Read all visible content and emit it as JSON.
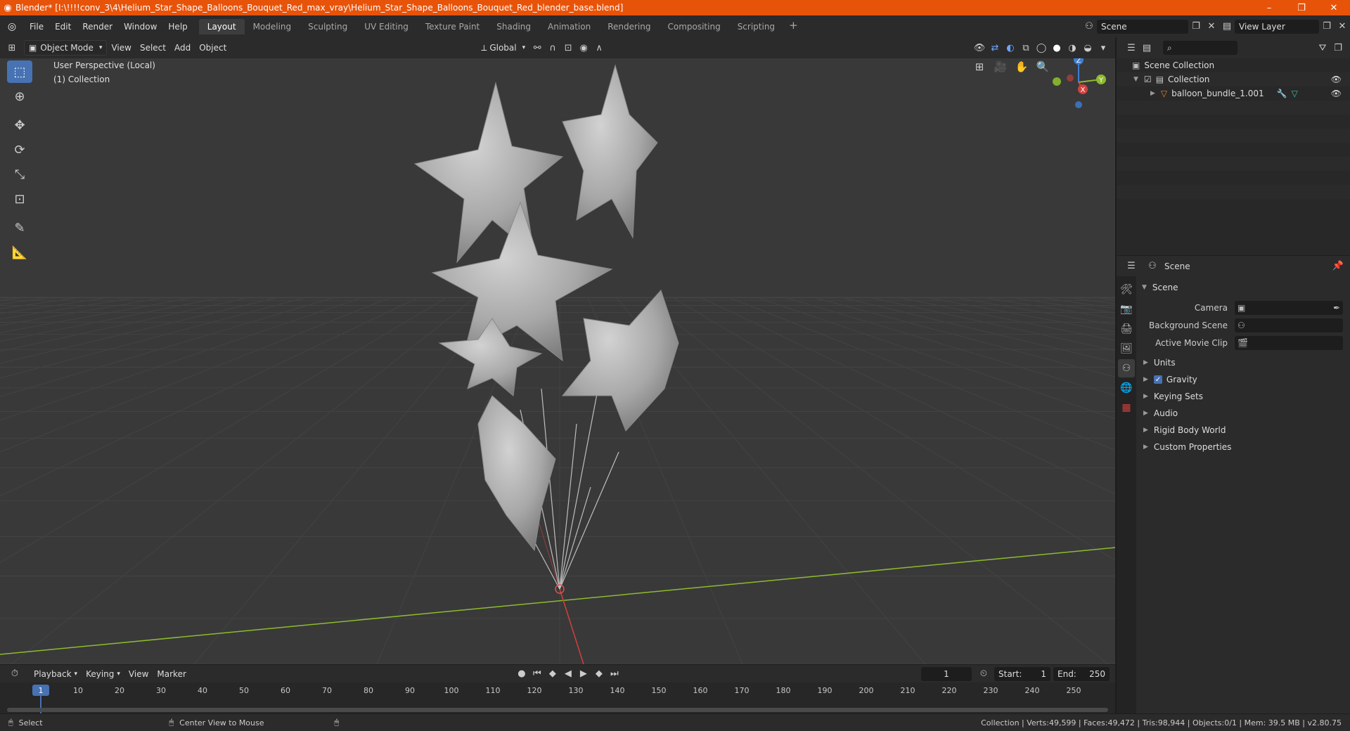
{
  "window": {
    "title": "Blender* [I:\\!!!!conv_3\\4\\Helium_Star_Shape_Balloons_Bouquet_Red_max_vray\\Helium_Star_Shape_Balloons_Bouquet_Red_blender_base.blend]",
    "minimize_icon": "minimize-icon",
    "maximize_icon": "restore-icon",
    "close_icon": "close-icon"
  },
  "menu": {
    "file": "File",
    "edit": "Edit",
    "render": "Render",
    "window": "Window",
    "help": "Help"
  },
  "workspaces": [
    "Layout",
    "Modeling",
    "Sculpting",
    "UV Editing",
    "Texture Paint",
    "Shading",
    "Animation",
    "Rendering",
    "Compositing",
    "Scripting"
  ],
  "active_workspace": "Layout",
  "scene_selector": {
    "value": "Scene"
  },
  "view_layer_selector": {
    "value": "View Layer"
  },
  "viewport_header": {
    "mode": "Object Mode",
    "view": "View",
    "select": "Select",
    "add": "Add",
    "object": "Object",
    "transform_orientation": "Global"
  },
  "viewport": {
    "perspective_label": "User Perspective (Local)",
    "collection_label": "(1) Collection",
    "gizmo_axes": {
      "z": "Z",
      "y": "Y",
      "x": "X"
    }
  },
  "outliner": {
    "search_placeholder": "",
    "items": [
      {
        "label": "Scene Collection",
        "icon": "scene-collection-icon"
      },
      {
        "label": "Collection",
        "icon": "collection-icon"
      },
      {
        "label": "balloon_bundle_1.001",
        "icon": "mesh-object-icon"
      }
    ]
  },
  "properties": {
    "header_title": "Scene",
    "panel_title": "Scene",
    "camera_label": "Camera",
    "background_scene_label": "Background Scene",
    "active_movie_clip_label": "Active Movie Clip",
    "subpanels": [
      "Units",
      "Gravity",
      "Keying Sets",
      "Audio",
      "Rigid Body World",
      "Custom Properties"
    ],
    "gravity_checked": true
  },
  "timeline": {
    "playback": "Playback",
    "keying": "Keying",
    "view": "View",
    "marker": "Marker",
    "current_frame": "1",
    "start_label": "Start:",
    "start_value": "1",
    "end_label": "End:",
    "end_value": "250",
    "ticks": [
      "1",
      "10",
      "20",
      "30",
      "40",
      "50",
      "60",
      "70",
      "80",
      "90",
      "100",
      "110",
      "120",
      "130",
      "140",
      "150",
      "160",
      "170",
      "180",
      "190",
      "200",
      "210",
      "220",
      "230",
      "240",
      "250"
    ]
  },
  "statusbar": {
    "select": "Select",
    "center_view": "Center View to Mouse",
    "stats": "Collection | Verts:49,599 | Faces:49,472 | Tris:98,944 | Objects:0/1 | Mem: 39.5 MB | v2.80.75"
  },
  "colors": {
    "title_bar": "#e8530a",
    "accent_blue": "#4772b3",
    "viewport_bg": "#393939",
    "x_axis": "#d0413f",
    "y_axis": "#8dbb2d",
    "z_axis": "#3c7ed4"
  }
}
